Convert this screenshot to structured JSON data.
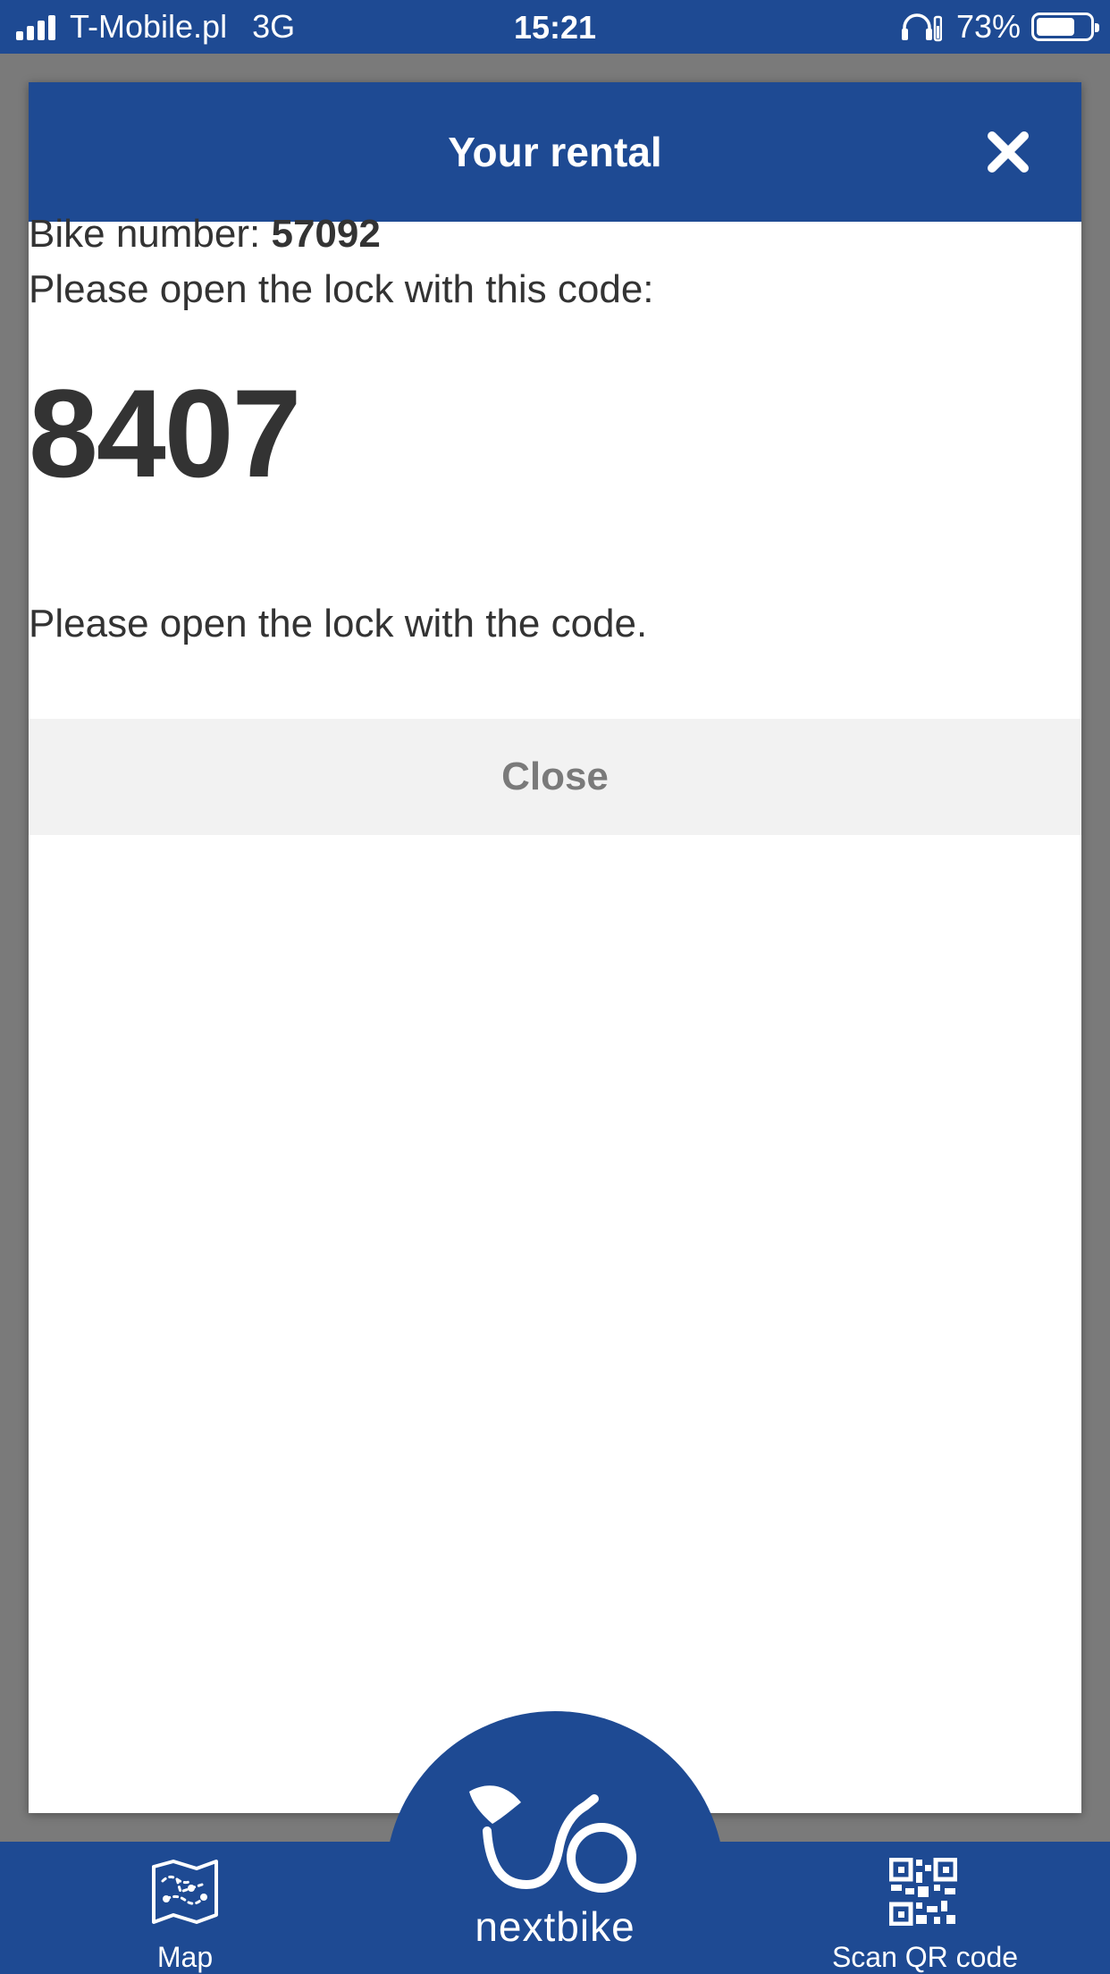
{
  "status_bar": {
    "carrier": "T-Mobile.pl",
    "network": "3G",
    "time": "15:21",
    "battery_percent": "73%",
    "battery_level": 0.73,
    "icons": [
      "signal-bars-icon",
      "headphones-icon",
      "battery-icon"
    ]
  },
  "modal": {
    "title": "Your rental",
    "close_icon": "close-x-icon",
    "bike_number_label": "Bike number:",
    "bike_number": "57092",
    "instruction_code": "Please open the lock with this code:",
    "lock_code": "8407",
    "instruction_hint": "Please open the lock with the code.",
    "close_button": "Close"
  },
  "bottom_nav": {
    "map_label": "Map",
    "map_icon": "folded-map-icon",
    "logo_text": "nextbike",
    "scan_label": "Scan QR code",
    "scan_icon": "qr-code-icon"
  },
  "colors": {
    "brand_blue": "#1e4a93",
    "overlay_gray": "#7a7a7a",
    "button_bg": "#f2f2f2",
    "button_text": "#7a7a7a",
    "text": "#333333"
  }
}
